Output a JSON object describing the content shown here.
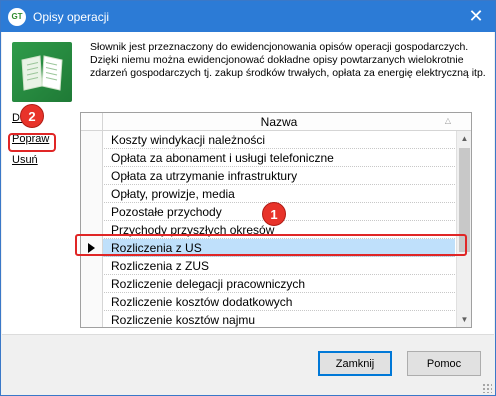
{
  "window": {
    "title": "Opisy operacji",
    "app_icon_text": "GT",
    "close_glyph": "✕"
  },
  "description": "Słownik jest przeznaczony do ewidencjonowania opisów operacji gospodarczych. Dzięki niemu można ewidencjonować dokładne opisy powtarzanych wielokrotnie zdarzeń gospodarczych tj. zakup środków trwałych, opłata za energię elektryczną itp.",
  "side_links": {
    "add": "Dodaj",
    "edit": "Popraw",
    "delete": "Usuń"
  },
  "grid": {
    "column_header": "Nazwa",
    "rows": [
      "Koszty windykacji należności",
      "Opłata za abonament i usługi telefoniczne",
      "Opłata za utrzymanie infrastruktury",
      "Opłaty, prowizje, media",
      "Pozostałe przychody",
      "Przychody przyszłych okresów",
      "Rozliczenia z US",
      "Rozliczenia z ZUS",
      "Rozliczenie delegacji pracowniczych",
      "Rozliczenie kosztów dodatkowych",
      "Rozliczenie kosztów najmu"
    ],
    "selected_row": "Rozliczenia z US"
  },
  "annotations": {
    "badge_1": "1",
    "badge_2": "2"
  },
  "buttons": {
    "close": "Zamknij",
    "help": "Pomoc"
  },
  "colors": {
    "titlebar": "#2c7bd6",
    "selection": "#bfe0fb",
    "highlight": "#e02626"
  },
  "icons": {
    "app": "app-logo-icon",
    "dictionary": "open-book-icon",
    "selected_row_marker": "row-pointer-icon"
  }
}
